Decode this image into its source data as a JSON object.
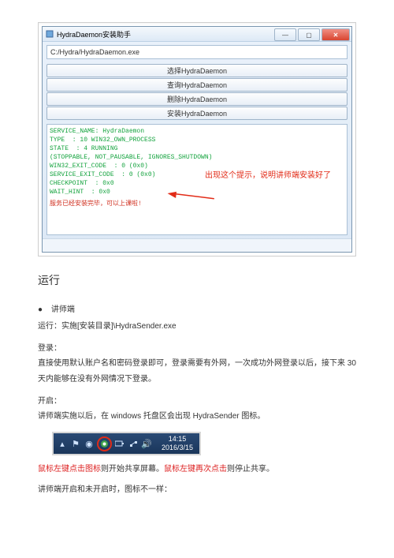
{
  "window": {
    "title": "HydraDaemon安装助手",
    "path": "C:/Hydra/HydraDaemon.exe",
    "buttons": {
      "select": "选择HydraDaemon",
      "query": "查询HydraDaemon",
      "delete": "删除HydraDaemon",
      "install": "安装HydraDaemon"
    },
    "console_lines": [
      "SERVICE_NAME: HydraDaemon",
      "TYPE  : 10 WIN32_OWN_PROCESS",
      "STATE  : 4 RUNNING",
      "(STOPPABLE, NOT_PAUSABLE, IGNORES_SHUTDOWN)",
      "WIN32_EXIT_CODE  : 0 (0x0)",
      "SERVICE_EXIT_CODE  : 0 (0x0)",
      "CHECKPOINT  : 0x0",
      "WAIT_HINT  : 0x0"
    ],
    "console_success": "服务已经安装完毕，可以上课啦!",
    "callout": "出现这个提示，说明讲师端安装好了"
  },
  "doc": {
    "section_title": "运行",
    "bullet1": "讲师端",
    "run_line": "运行：实施[安装目录]\\HydraSender.exe",
    "login_label": "登录：",
    "login_text": "直接使用默认账户名和密码登录即可，登录需要有外网，一次成功外网登录以后，接下来 30 天内能够在没有外网情况下登录。",
    "start_label": "开启：",
    "start_text": "讲师端实施以后，在 windows 托盘区会出现 HydraSender 图标。",
    "click_prefix": "鼠标左键点击图标",
    "click_mid1": "则开始共享屏幕。",
    "click_red2": "鼠标左键再次点击",
    "click_mid2": "则停止共享。",
    "tail": "讲师端开启和未开启时，图标不一样："
  },
  "tray": {
    "time": "14:15",
    "date": "2016/3/15"
  }
}
